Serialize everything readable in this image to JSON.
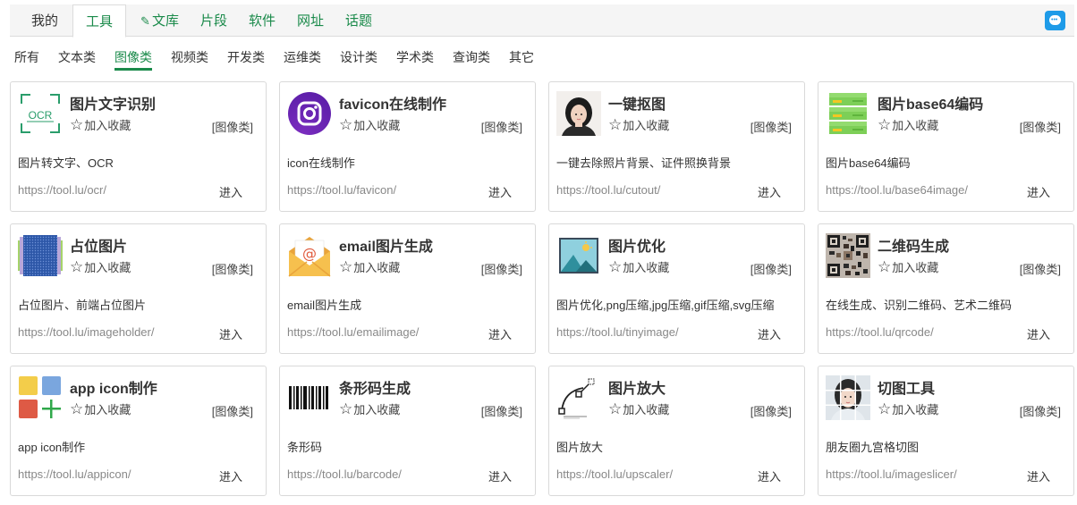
{
  "top_tabs": [
    {
      "label": "我的"
    },
    {
      "label": "工具"
    },
    {
      "label": "文库"
    },
    {
      "label": "片段"
    },
    {
      "label": "软件"
    },
    {
      "label": "网址"
    },
    {
      "label": "话题"
    }
  ],
  "categories": [
    "所有",
    "文本类",
    "图像类",
    "视频类",
    "开发类",
    "运维类",
    "设计类",
    "学术类",
    "查询类",
    "其它"
  ],
  "active_category": "图像类",
  "colors": {
    "accent": "#1a8a4a",
    "chat_button": "#1e9be8"
  },
  "common": {
    "favorite_label": "加入收藏",
    "enter_label": "进入"
  },
  "tools": [
    {
      "title": "图片文字识别",
      "category": "[图像类]",
      "desc": "图片转文字、OCR",
      "url": "https://tool.lu/ocr/",
      "icon": "ocr-icon",
      "icon_text": "OCR"
    },
    {
      "title": "favicon在线制作",
      "category": "[图像类]",
      "desc": "icon在线制作",
      "url": "https://tool.lu/favicon/",
      "icon": "instagram-favicon-icon"
    },
    {
      "title": "一键抠图",
      "category": "[图像类]",
      "desc": "一键去除照片背景、证件照换背景",
      "url": "https://tool.lu/cutout/",
      "icon": "portrait-photo-icon"
    },
    {
      "title": "图片base64编码",
      "category": "[图像类]",
      "desc": "图片base64编码",
      "url": "https://tool.lu/base64image/",
      "icon": "server-stack-icon"
    },
    {
      "title": "占位图片",
      "category": "[图像类]",
      "desc": "占位图片、前端占位图片",
      "url": "https://tool.lu/imageholder/",
      "icon": "placeholder-image-icon"
    },
    {
      "title": "email图片生成",
      "category": "[图像类]",
      "desc": "email图片生成",
      "url": "https://tool.lu/emailimage/",
      "icon": "email-envelope-icon"
    },
    {
      "title": "图片优化",
      "category": "[图像类]",
      "desc": "图片优化,png压缩,jpg压缩,gif压缩,svg压缩",
      "url": "https://tool.lu/tinyimage/",
      "icon": "landscape-image-icon"
    },
    {
      "title": "二维码生成",
      "category": "[图像类]",
      "desc": "在线生成、识别二维码、艺术二维码",
      "url": "https://tool.lu/qrcode/",
      "icon": "qr-code-icon"
    },
    {
      "title": "app icon制作",
      "category": "[图像类]",
      "desc": "app icon制作",
      "url": "https://tool.lu/appicon/",
      "icon": "app-tiles-icon"
    },
    {
      "title": "条形码生成",
      "category": "[图像类]",
      "desc": "条形码",
      "url": "https://tool.lu/barcode/",
      "icon": "barcode-icon"
    },
    {
      "title": "图片放大",
      "category": "[图像类]",
      "desc": "图片放大",
      "url": "https://tool.lu/upscaler/",
      "icon": "vector-curve-icon"
    },
    {
      "title": "切图工具",
      "category": "[图像类]",
      "desc": "朋友圈九宫格切图",
      "url": "https://tool.lu/imageslicer/",
      "icon": "nine-grid-photo-icon"
    }
  ]
}
